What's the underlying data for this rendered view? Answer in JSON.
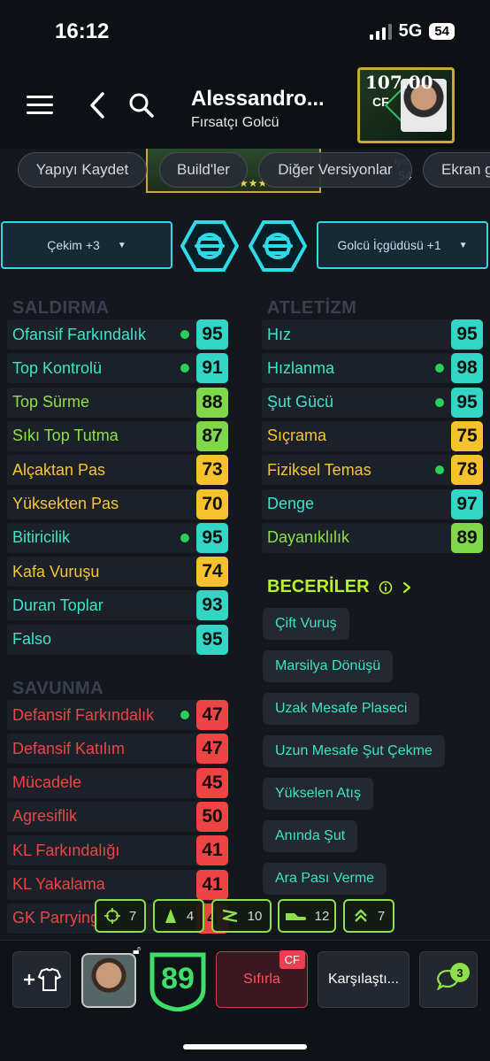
{
  "status": {
    "time": "16:12",
    "network": "5G",
    "battery": "54"
  },
  "header": {
    "name": "Alessandro...",
    "role": "Fırsatçı Golcü",
    "card_rating": "107.00",
    "card_position": "CF"
  },
  "tabs": [
    "Yapıyı Kaydet",
    "Build'ler",
    "Diğer Versiyonlar",
    "Ekran g"
  ],
  "peek": {
    "label": "iye",
    "value": "54"
  },
  "boosts": {
    "left": "Çekim +3",
    "right": "Golcü İçgüdüsü +1"
  },
  "sections": {
    "attack": "SALDIRMA",
    "athletic": "ATLETİZM",
    "defense": "SAVUNMA",
    "skills": "BECERİLER"
  },
  "attack_stats": [
    {
      "label": "Ofansif Farkındalık",
      "value": "95",
      "dot": true,
      "color": "#3fe3c8",
      "badge": "#33d6c4"
    },
    {
      "label": "Top Kontrolü",
      "value": "91",
      "dot": true,
      "color": "#3fe3c8",
      "badge": "#33d6c4"
    },
    {
      "label": "Top Sürme",
      "value": "88",
      "dot": false,
      "color": "#8ee04b",
      "badge": "#7fd84a"
    },
    {
      "label": "Sıkı Top Tutma",
      "value": "87",
      "dot": false,
      "color": "#8ee04b",
      "badge": "#7fd84a"
    },
    {
      "label": "Alçaktan Pas",
      "value": "73",
      "dot": false,
      "color": "#f6c633",
      "badge": "#f5c12d"
    },
    {
      "label": "Yüksekten Pas",
      "value": "70",
      "dot": false,
      "color": "#f6c633",
      "badge": "#f5c12d"
    },
    {
      "label": "Bitiricilik",
      "value": "95",
      "dot": true,
      "color": "#3fe3c8",
      "badge": "#33d6c4"
    },
    {
      "label": "Kafa Vuruşu",
      "value": "74",
      "dot": false,
      "color": "#f6c633",
      "badge": "#f5c12d"
    },
    {
      "label": "Duran Toplar",
      "value": "93",
      "dot": false,
      "color": "#3fe3c8",
      "badge": "#33d6c4"
    },
    {
      "label": "Falso",
      "value": "95",
      "dot": false,
      "color": "#3fe3c8",
      "badge": "#33d6c4"
    }
  ],
  "athletic_stats": [
    {
      "label": "Hız",
      "value": "95",
      "dot": false,
      "color": "#3fe3c8",
      "badge": "#33d6c4"
    },
    {
      "label": "Hızlanma",
      "value": "98",
      "dot": true,
      "color": "#3fe3c8",
      "badge": "#33d6c4"
    },
    {
      "label": "Şut Gücü",
      "value": "95",
      "dot": true,
      "color": "#3fe3c8",
      "badge": "#33d6c4"
    },
    {
      "label": "Sıçrama",
      "value": "75",
      "dot": false,
      "color": "#f6c633",
      "badge": "#f5c12d"
    },
    {
      "label": "Fiziksel Temas",
      "value": "78",
      "dot": true,
      "color": "#f6c633",
      "badge": "#f5c12d"
    },
    {
      "label": "Denge",
      "value": "97",
      "dot": false,
      "color": "#3fe3c8",
      "badge": "#33d6c4"
    },
    {
      "label": "Dayanıklılık",
      "value": "89",
      "dot": false,
      "color": "#8ee04b",
      "badge": "#7fd84a"
    }
  ],
  "defense_stats": [
    {
      "label": "Defansif Farkındalık",
      "value": "47",
      "dot": true,
      "color": "#ef4545",
      "badge": "#ef4444"
    },
    {
      "label": "Defansif Katılım",
      "value": "47",
      "dot": false,
      "color": "#ef4545",
      "badge": "#ef4444"
    },
    {
      "label": "Mücadele",
      "value": "45",
      "dot": false,
      "color": "#ef4545",
      "badge": "#ef4444"
    },
    {
      "label": "Agresiflik",
      "value": "50",
      "dot": false,
      "color": "#ef4545",
      "badge": "#ef4444"
    },
    {
      "label": "KL Farkındalığı",
      "value": "41",
      "dot": false,
      "color": "#ef4545",
      "badge": "#ef4444"
    },
    {
      "label": "KL Yakalama",
      "value": "41",
      "dot": false,
      "color": "#ef4545",
      "badge": "#ef4444"
    },
    {
      "label": "GK Parrying",
      "value": "4",
      "dot": false,
      "color": "#ef4545",
      "badge": "#ef4444"
    }
  ],
  "skills": [
    "Çift Vuruş",
    "Marsilya Dönüşü",
    "Uzak Mesafe Plaseci",
    "Uzun Mesafe Şut Çekme",
    "Yükselen Atış",
    "Anında Şut",
    "Ara Pası Verme"
  ],
  "counters": [
    {
      "icon": "crosshair-icon",
      "value": "7"
    },
    {
      "icon": "cone-icon",
      "value": "4"
    },
    {
      "icon": "zigzag-icon",
      "value": "10"
    },
    {
      "icon": "boot-icon",
      "value": "12"
    },
    {
      "icon": "double-chevron-up-icon",
      "value": "7"
    }
  ],
  "bottom": {
    "overall": "89",
    "reset_label": "Sıfırla",
    "reset_badge": "CF",
    "compare_label": "Karşılaştı...",
    "chat_badge": "3"
  }
}
